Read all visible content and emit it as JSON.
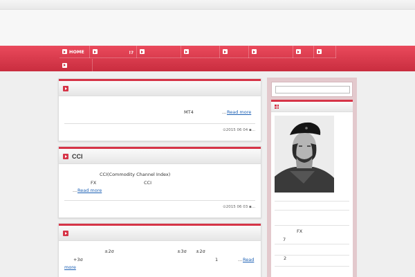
{
  "nav": {
    "row1": [
      {
        "label": "HOME"
      },
      {
        "label": ""
      },
      {
        "label": "　　　　　!?"
      },
      {
        "label": ""
      },
      {
        "label": ""
      },
      {
        "label": ""
      },
      {
        "label": ""
      },
      {
        "label": ""
      },
      {
        "label": ""
      }
    ],
    "row2": [
      {
        "label": ""
      }
    ]
  },
  "posts": [
    {
      "title": "",
      "lines": [
        "MT4"
      ],
      "read_more": "Read more",
      "ellipsis": "...",
      "date": "2015 06 04",
      "after_date": "..."
    },
    {
      "title": "CCI",
      "lines": [
        "CCI(Commodity Channel Index)",
        "FX",
        "CCI"
      ],
      "read_more": "Read more",
      "ellipsis": "...",
      "date": "2015 06 03",
      "after_date": "..."
    },
    {
      "title": "",
      "lines": [
        "±2σ",
        "±3σ",
        "±2σ",
        "+3σ",
        "1"
      ],
      "read_more_1": "Read",
      "read_more_2": "more",
      "ellipsis": "..."
    }
  ],
  "sidebar": {
    "search_placeholder": "",
    "items": [
      "FX",
      "7",
      "2"
    ]
  }
}
